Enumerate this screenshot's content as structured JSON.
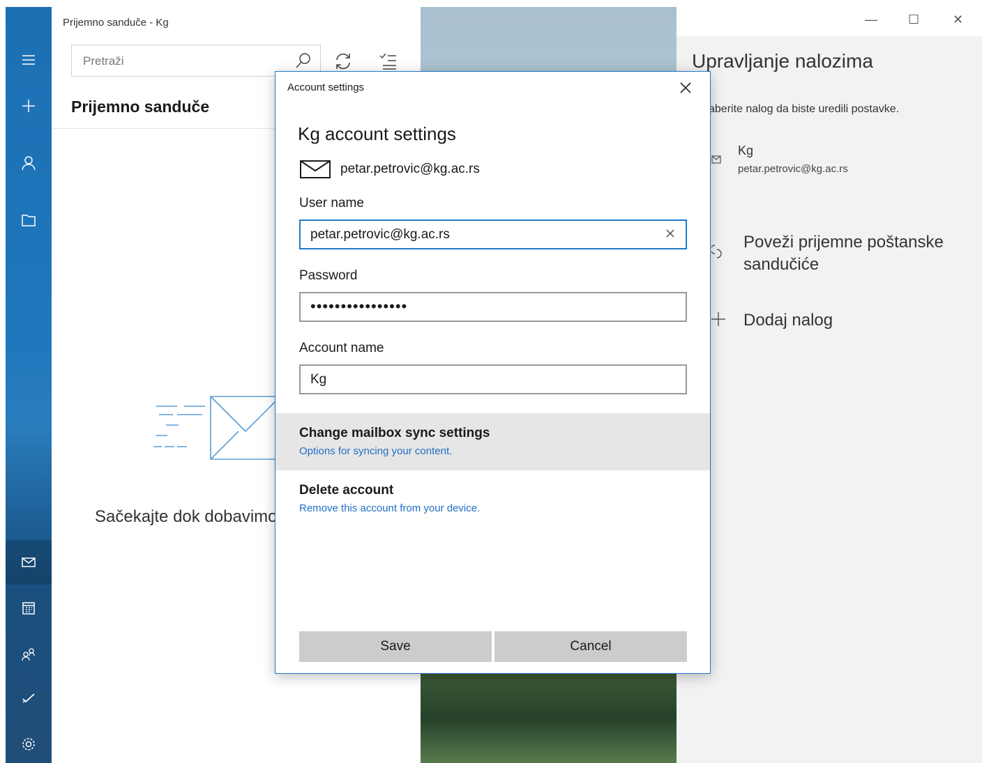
{
  "window": {
    "title": "Prijemno sanduče - Kg",
    "controls": {
      "minimize": "—",
      "maximize": "☐",
      "close": "✕"
    }
  },
  "rail": {
    "items": [
      {
        "icon": "hamburger-menu-icon"
      },
      {
        "icon": "plus-icon"
      },
      {
        "icon": "person-icon"
      },
      {
        "icon": "folder-icon"
      },
      {
        "icon": "mail-icon",
        "active": true
      },
      {
        "icon": "calendar-icon"
      },
      {
        "icon": "people-icon"
      },
      {
        "icon": "todo-check-icon"
      },
      {
        "icon": "settings-gear-icon"
      }
    ]
  },
  "list": {
    "search_placeholder": "Pretraži",
    "folder_title": "Prijemno sanduče",
    "loading_text": "Sačekajte dok dobavimo"
  },
  "manage_accounts": {
    "title": "Upravljanje nalozima",
    "subtitle": "aberite nalog da biste uredili postavke.",
    "account": {
      "name": "Kg",
      "email": "petar.petrovic@kg.ac.rs"
    },
    "link_inboxes": "Poveži prijemne poštanske sandučiće",
    "add_account": "Dodaj nalog"
  },
  "dialog": {
    "title": "Account settings",
    "heading": "Kg account settings",
    "email": "petar.petrovic@kg.ac.rs",
    "username_label": "User name",
    "username_value": "petar.petrovic@kg.ac.rs",
    "password_label": "Password",
    "password_value": "••••••••••••••••",
    "account_name_label": "Account name",
    "account_name_value": "Kg",
    "sync_title": "Change mailbox sync settings",
    "sync_sub": "Options for syncing your content.",
    "delete_title": "Delete account",
    "delete_sub": "Remove this account from your device.",
    "save_label": "Save",
    "cancel_label": "Cancel"
  },
  "colors": {
    "accent": "#1f78c8",
    "rail": "#1d6fb3",
    "link": "#1f6fc4"
  }
}
